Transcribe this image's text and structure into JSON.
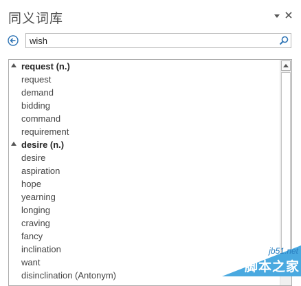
{
  "pane": {
    "title": "同义词库",
    "options_icon": "chevron-down-icon",
    "close_icon": "close-icon"
  },
  "search": {
    "value": "wish",
    "back_icon": "back-arrow-icon",
    "search_icon": "magnifier-icon"
  },
  "results": {
    "groups": [
      {
        "heading": "request (n.)",
        "items": [
          "request",
          "demand",
          "bidding",
          "command",
          "requirement"
        ]
      },
      {
        "heading": "desire (n.)",
        "items": [
          "desire",
          "aspiration",
          "hope",
          "yearning",
          "longing",
          "craving",
          "fancy",
          "inclination",
          "want",
          "disinclination (Antonym)"
        ]
      }
    ]
  },
  "watermark": {
    "site": "jb51.net",
    "name": "脚本之家"
  },
  "colors": {
    "accent": "#2e74b5",
    "watermark_blue": "#4aa9e0"
  }
}
